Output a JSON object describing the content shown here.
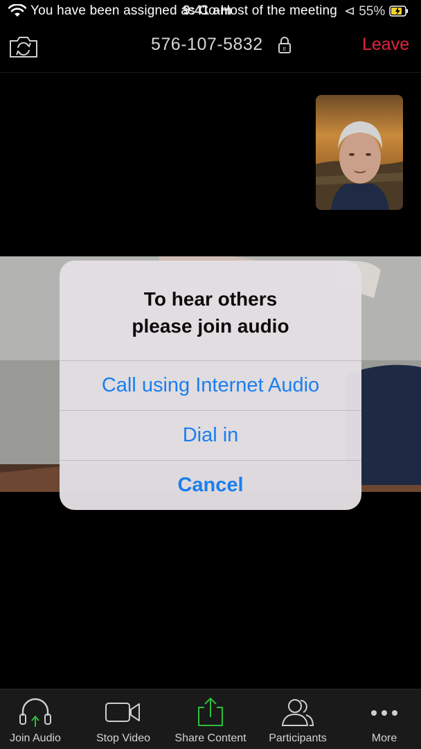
{
  "status_bar": {
    "banner": "You have been assigned as Co-Host of the meeting",
    "time": "9:41 am",
    "right": "⊲ 55%"
  },
  "meeting": {
    "id": "576-107-5832",
    "leave_label": "Leave"
  },
  "dialog": {
    "title_line1": "To hear others",
    "title_line2": "please join audio",
    "options": [
      {
        "label": "Call using Internet Audio"
      },
      {
        "label": "Dial in"
      },
      {
        "label": "Cancel"
      }
    ]
  },
  "toolbar": {
    "items": [
      {
        "label": "Join Audio",
        "icon": "headphones-icon"
      },
      {
        "label": "Stop Video",
        "icon": "video-camera-icon"
      },
      {
        "label": "Share Content",
        "icon": "share-upload-icon"
      },
      {
        "label": "Participants",
        "icon": "participants-icon"
      },
      {
        "label": "More",
        "icon": "more-dots-icon"
      }
    ]
  },
  "colors": {
    "accent": "#1a7ef0",
    "leave": "#e0253d",
    "share": "#2fbe3f"
  }
}
